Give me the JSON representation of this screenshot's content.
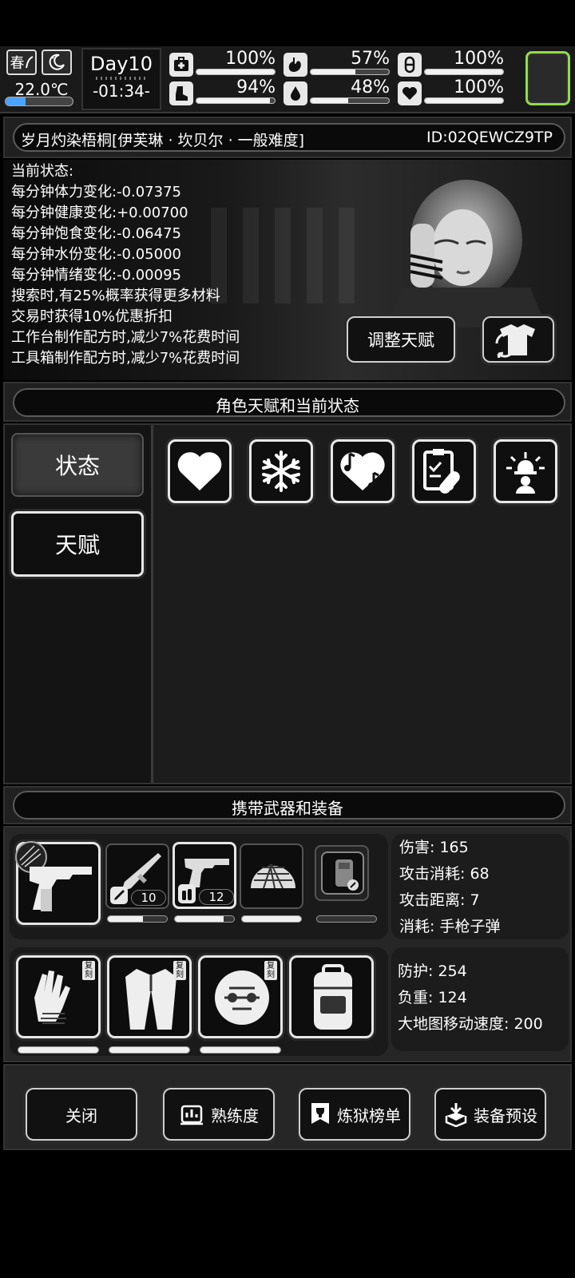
{
  "hud": {
    "season": "春",
    "temperature": "22.0℃",
    "day": "Day10",
    "time": "-01:34-",
    "stats": [
      {
        "icon": "medkit-icon",
        "pct": "100%",
        "value": 1.0
      },
      {
        "icon": "stomach-icon",
        "pct": "57%",
        "value": 0.57
      },
      {
        "icon": "pill-icon",
        "pct": "100%",
        "value": 1.0
      },
      {
        "icon": "boot-icon",
        "pct": "94%",
        "value": 0.94
      },
      {
        "icon": "water-drop-icon",
        "pct": "48%",
        "value": 0.48
      },
      {
        "icon": "heart-icon",
        "pct": "100%",
        "value": 1.0
      }
    ]
  },
  "title": {
    "name": "岁月灼染梧桐[伊芙琳 · 坎贝尔 · 一般难度]",
    "id": "ID:02QEWCZ9TP"
  },
  "status": {
    "heading": "当前状态:",
    "lines": [
      "每分钟体力变化:-0.07375",
      "每分钟健康变化:+0.00700",
      "每分钟饱食变化:-0.06475",
      "每分钟水份变化:-0.05000",
      "每分钟情绪变化:-0.00095",
      "搜索时,有25%概率获得更多材料",
      "交易时获得10%优惠折扣",
      "工作台制作配方时,减少7%花费时间",
      "工具箱制作配方时,减少7%花费时间"
    ],
    "adjust_button": "调整天赋"
  },
  "talent_section": {
    "header": "角色天赋和当前状态",
    "tab_status": "状态",
    "tab_talent": "天赋"
  },
  "equip_section": {
    "header": "携带武器和装备",
    "weapons": [
      {
        "name": "rifle-icon",
        "ammo": "10",
        "durability": 0.6
      },
      {
        "name": "pistol-icon",
        "ammo": "12",
        "durability": 0.82
      },
      {
        "name": "helmet-icon",
        "durability": 1.0
      },
      {
        "name": "shield-icon",
        "durability": 0.0
      }
    ],
    "weapon_info": {
      "damage": "伤害: 165",
      "attack_cost": "攻击消耗: 68",
      "attack_range": "攻击距离: 7",
      "consume": "消耗: 手枪子弹"
    },
    "armor": [
      {
        "name": "gloves-icon",
        "badge": "复刻",
        "durability": 1.0
      },
      {
        "name": "coat-icon",
        "badge": "复刻",
        "durability": 1.0
      },
      {
        "name": "armor-helmet-icon",
        "badge": "复刻",
        "durability": 1.0
      },
      {
        "name": "backpack-icon",
        "badge": "",
        "durability": 0.0
      }
    ],
    "armor_info": {
      "defense": "防护: 254",
      "load": "负重: 124",
      "map_speed": "大地图移动速度: 200"
    }
  },
  "bottom": {
    "close": "关闭",
    "proficiency": "熟练度",
    "leaderboard": "炼狱榜单",
    "preset": "装备预设"
  }
}
